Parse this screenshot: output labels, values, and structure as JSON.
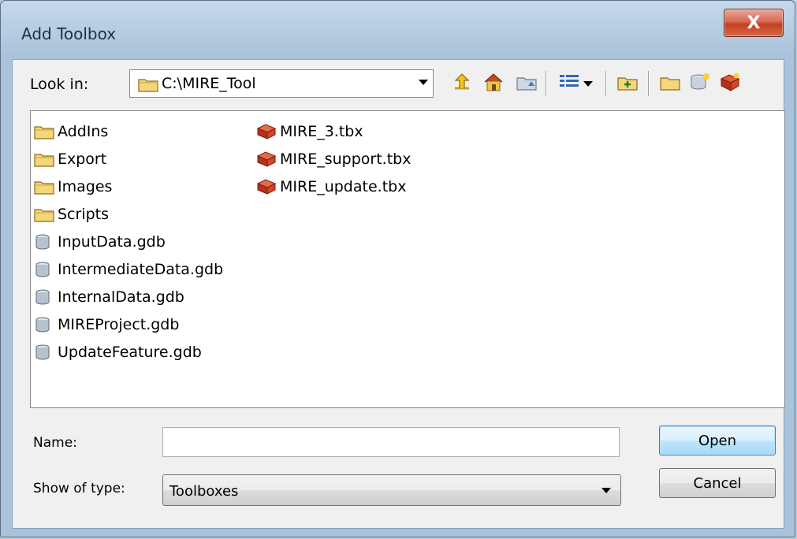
{
  "window": {
    "title": "Add Toolbox",
    "close_glyph": "X"
  },
  "lookin": {
    "label": "Look in:",
    "path": "C:\\MIRE_Tool"
  },
  "toolbar": {
    "icons": [
      "up-one-level-icon",
      "home-icon",
      "connect-folder-icon",
      "view-menu-icon",
      "new-folder-icon",
      "folder-icon",
      "new-geodatabase-icon",
      "toolbox-icon"
    ]
  },
  "files": [
    {
      "name": "AddIns",
      "type": "folder"
    },
    {
      "name": "Export",
      "type": "folder"
    },
    {
      "name": "Images",
      "type": "folder"
    },
    {
      "name": "Scripts",
      "type": "folder"
    },
    {
      "name": "InputData.gdb",
      "type": "gdb"
    },
    {
      "name": "IntermediateData.gdb",
      "type": "gdb"
    },
    {
      "name": "InternalData.gdb",
      "type": "gdb"
    },
    {
      "name": "MIREProject.gdb",
      "type": "gdb"
    },
    {
      "name": "UpdateFeature.gdb",
      "type": "gdb"
    },
    {
      "name": "MIRE_3.tbx",
      "type": "toolbox"
    },
    {
      "name": "MIRE_support.tbx",
      "type": "toolbox"
    },
    {
      "name": "MIRE_update.tbx",
      "type": "toolbox"
    }
  ],
  "form": {
    "name_label": "Name:",
    "name_value": "",
    "type_label": "Show of type:",
    "type_value": "Toolboxes"
  },
  "buttons": {
    "open": "Open",
    "cancel": "Cancel"
  },
  "colors": {
    "folder": "#e8c562",
    "gdb": "#6c7f96",
    "toolbox": "#c0392b"
  }
}
